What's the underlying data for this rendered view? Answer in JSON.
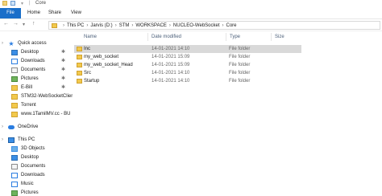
{
  "window": {
    "title": "Core"
  },
  "ribbon": {
    "file_label": "File",
    "tabs": [
      "Home",
      "Share",
      "View"
    ]
  },
  "address": {
    "crumbs": [
      "This PC",
      "Jarvis (D:)",
      "STM",
      "WORKSPACE",
      "NUCLEO-WebSocket",
      "Core"
    ]
  },
  "nav": {
    "items": [
      {
        "label": "Quick access",
        "icon": "star-icon",
        "pinned": false
      },
      {
        "label": "Desktop",
        "icon": "desktop-icon",
        "pinned": true
      },
      {
        "label": "Downloads",
        "icon": "download-icon",
        "pinned": true
      },
      {
        "label": "Documents",
        "icon": "documents-icon",
        "pinned": true
      },
      {
        "label": "Pictures",
        "icon": "pictures-icon",
        "pinned": true
      },
      {
        "label": "E-Bill",
        "icon": "folder-icon",
        "pinned": true
      },
      {
        "label": "STM32-WebSocketClier",
        "icon": "folder-icon",
        "pinned": false
      },
      {
        "label": "Torrent",
        "icon": "folder-icon",
        "pinned": false
      },
      {
        "label": "www.1TamilMV.cc - BU",
        "icon": "folder-icon",
        "pinned": false
      },
      {
        "label": "OneDrive",
        "icon": "onedrive-icon",
        "pinned": false
      },
      {
        "label": "This PC",
        "icon": "pc-icon",
        "pinned": false
      },
      {
        "label": "3D Objects",
        "icon": "3d-objects-icon",
        "pinned": false
      },
      {
        "label": "Desktop",
        "icon": "desktop-icon",
        "pinned": false
      },
      {
        "label": "Documents",
        "icon": "documents-icon",
        "pinned": false
      },
      {
        "label": "Downloads",
        "icon": "download-icon",
        "pinned": false
      },
      {
        "label": "Music",
        "icon": "music-icon",
        "pinned": false
      },
      {
        "label": "Pictures",
        "icon": "pictures-icon",
        "pinned": false
      }
    ]
  },
  "columns": {
    "name": "Name",
    "date": "Date modified",
    "type": "Type",
    "size": "Size"
  },
  "files": [
    {
      "name": "Inc",
      "date": "14-01-2021 14:10",
      "type": "File folder",
      "selected": true
    },
    {
      "name": "my_web_socket",
      "date": "14-01-2021 15:09",
      "type": "File folder",
      "selected": false
    },
    {
      "name": "my_web_socket_Head",
      "date": "14-01-2021 15:09",
      "type": "File folder",
      "selected": false
    },
    {
      "name": "Src",
      "date": "14-01-2021 14:10",
      "type": "File folder",
      "selected": false
    },
    {
      "name": "Startup",
      "date": "14-01-2021 14:10",
      "type": "File folder",
      "selected": false
    }
  ]
}
